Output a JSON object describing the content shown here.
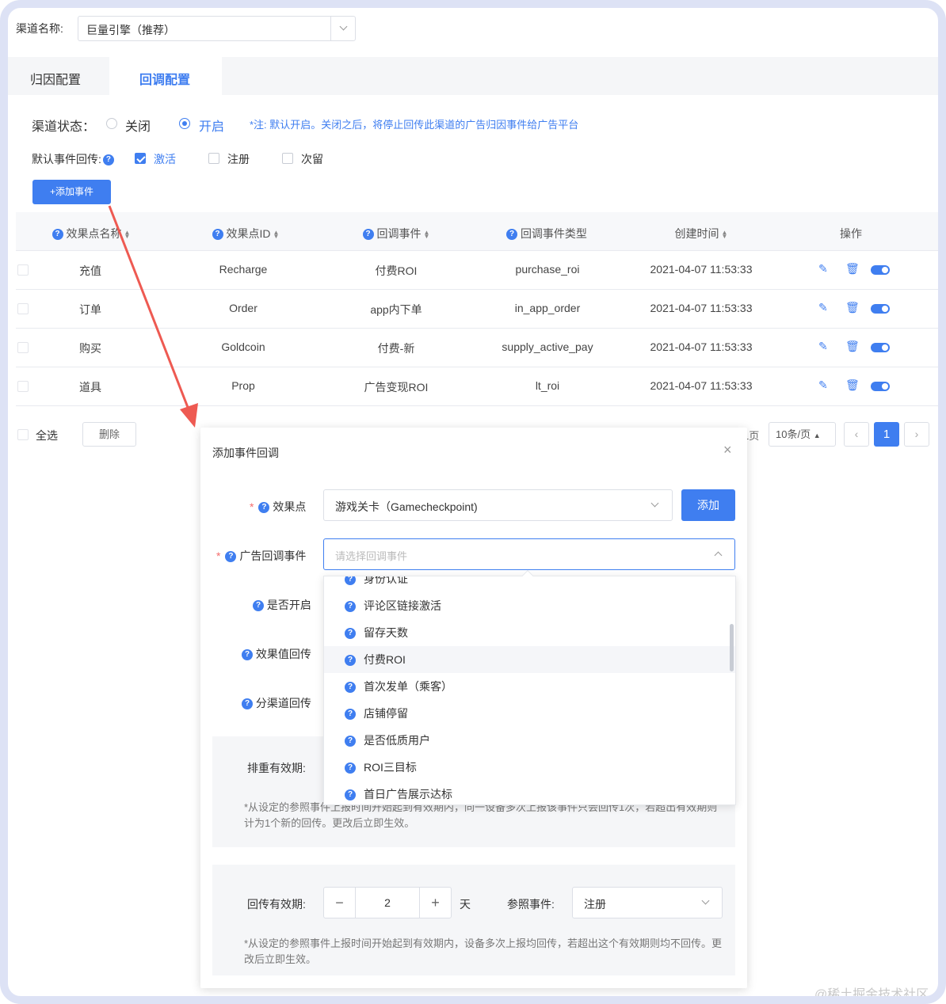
{
  "channel": {
    "label": "渠道名称:",
    "value": "巨量引擎（推荐）"
  },
  "tabs": [
    {
      "label": "归因配置",
      "active": false
    },
    {
      "label": "回调配置",
      "active": true
    }
  ],
  "status": {
    "label": "渠道状态：",
    "off": "关闭",
    "on": "开启",
    "note": "*注: 默认开启。关闭之后，将停止回传此渠道的广告归因事件给广告平台"
  },
  "default_events": {
    "label": "默认事件回传:",
    "items": [
      {
        "label": "激活",
        "checked": true
      },
      {
        "label": "注册",
        "checked": false
      },
      {
        "label": "次留",
        "checked": false
      }
    ]
  },
  "add_event_button": "+添加事件",
  "table": {
    "headers": [
      "效果点名称",
      "效果点ID",
      "回调事件",
      "回调事件类型",
      "创建时间",
      "操作"
    ],
    "rows": [
      {
        "name": "充值",
        "id": "Recharge",
        "event": "付费ROI",
        "type": "purchase_roi",
        "time": "2021-04-07 11:53:33"
      },
      {
        "name": "订单",
        "id": "Order",
        "event": "app内下单",
        "type": "in_app_order",
        "time": "2021-04-07 11:53:33"
      },
      {
        "name": "购买",
        "id": "Goldcoin",
        "event": "付费-新",
        "type": "supply_active_pay",
        "time": "2021-04-07 11:53:33"
      },
      {
        "name": "道具",
        "id": "Prop",
        "event": "广告变现ROI",
        "type": "lt_roi",
        "time": "2021-04-07 11:53:33"
      }
    ]
  },
  "footer": {
    "select_all": "全选",
    "delete": "删除",
    "page_suffix": "1页",
    "page_size": "10条/页",
    "current_page": "1"
  },
  "modal": {
    "title": "添加事件回调",
    "effect_point": {
      "label": "效果点",
      "value": "游戏关卡（Gamecheckpoint)"
    },
    "add_button": "添加",
    "ad_event": {
      "label": "广告回调事件",
      "placeholder": "请选择回调事件"
    },
    "enabled_label": "是否开启",
    "value_return_label": "效果值回传",
    "subchannel_label": "分渠道回传",
    "dedup": {
      "label": "排重有效期:",
      "note": "*从设定的参照事件上报时间开始起到有效期内，同一设备多次上报该事件只会回传1次，若超出有效期则计为1个新的回传。更改后立即生效。"
    },
    "return_period": {
      "label": "回传有效期:",
      "value": "2",
      "unit": "天",
      "ref_label": "参照事件:",
      "ref_value": "注册",
      "note": "*从设定的参照事件上报时间开始起到有效期内，设备多次上报均回传，若超出这个有效期则均不回传。更改后立即生效。"
    }
  },
  "dropdown_options": [
    "身份认证",
    "评论区链接激活",
    "留存天数",
    "付费ROI",
    "首次发单（乘客）",
    "店铺停留",
    "是否低质用户",
    "ROI三目标",
    "首日广告展示达标"
  ],
  "watermark": "@稀土掘金技术社区",
  "colors": {
    "accent": "#3f7ef0",
    "arrow": "#ee5a52",
    "border": "#dde2f5"
  }
}
